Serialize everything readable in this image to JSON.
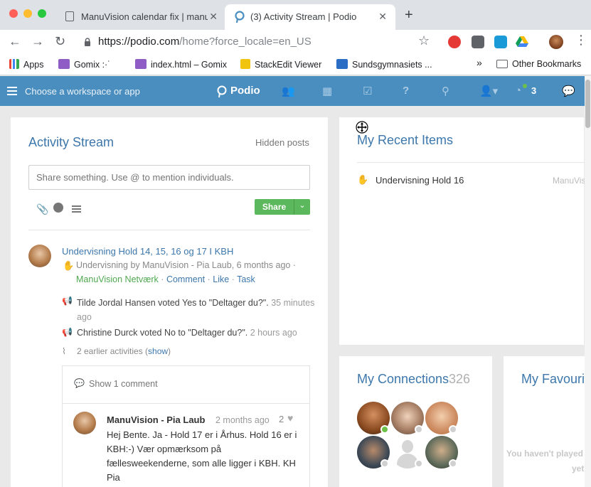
{
  "browser": {
    "tabs": [
      {
        "title": "ManuVision calendar fix | manu"
      },
      {
        "title": "(3) Activity Stream | Podio"
      }
    ],
    "url_domain": "https://podio.com",
    "url_path": "/home?force_locale=en_US",
    "bookmarks": [
      "Apps",
      "Gomix :·˙",
      "index.html – Gomix",
      "StackEdit Viewer",
      "Sundsgymnasiets ...",
      "Other Bookmarks"
    ],
    "overflow": "»"
  },
  "header": {
    "workspace_label": "Choose a workspace or app",
    "logo": "Podio",
    "notifications_count": "3"
  },
  "activity": {
    "title": "Activity Stream",
    "hidden_posts": "Hidden posts",
    "share_placeholder": "Share something. Use @ to mention individuals.",
    "share_button": "Share",
    "item": {
      "title": "Undervisning Hold 14, 15, 16 og 17 I KBH",
      "meta_prefix": "Undervisning",
      "meta_by": "by",
      "meta_author": "ManuVision - Pia Laub",
      "meta_time": ", 6 months ago ·",
      "workspace": "ManuVision Netværk",
      "action_comment": "Comment",
      "action_like": "Like",
      "action_task": "Task",
      "sep": "·",
      "votes": [
        {
          "text": "Tilde Jordal Hansen voted Yes to \"Deltager du?\".",
          "time": "35 minutes",
          "time2": "ago"
        },
        {
          "text": "Christine Durck voted No to \"Deltager du?\".",
          "time": "2 hours ago",
          "time2": ""
        }
      ],
      "earlier_prefix": "2 earlier activities (",
      "earlier_link": "show",
      "earlier_suffix": ")",
      "show_comment": "Show 1 comment",
      "comment": {
        "author": "ManuVision - Pia Laub",
        "time": "2 months ago",
        "likes": "2",
        "lines": [
          "Hej Bente. Ja - Hold 17 er i Århus. Hold 16 er i",
          "KBH:-) Vær opmærksom på",
          "fællesweekenderne, som alle ligger i KBH. KH",
          "Pia"
        ]
      }
    }
  },
  "recent": {
    "title": "My Recent Items",
    "item_label": "Undervisning Hold 16",
    "item_workspace": "ManuVis"
  },
  "connections": {
    "title": "My Connections",
    "count": "326"
  },
  "favourites": {
    "title": "My Favourite",
    "empty_line1": "You haven't played",
    "empty_line2": "yet."
  },
  "colors": {
    "podio_blue": "#4a8ec0",
    "link_blue": "#3d77ab",
    "share_green": "#5cb85c",
    "online_green": "#6cc04a"
  }
}
